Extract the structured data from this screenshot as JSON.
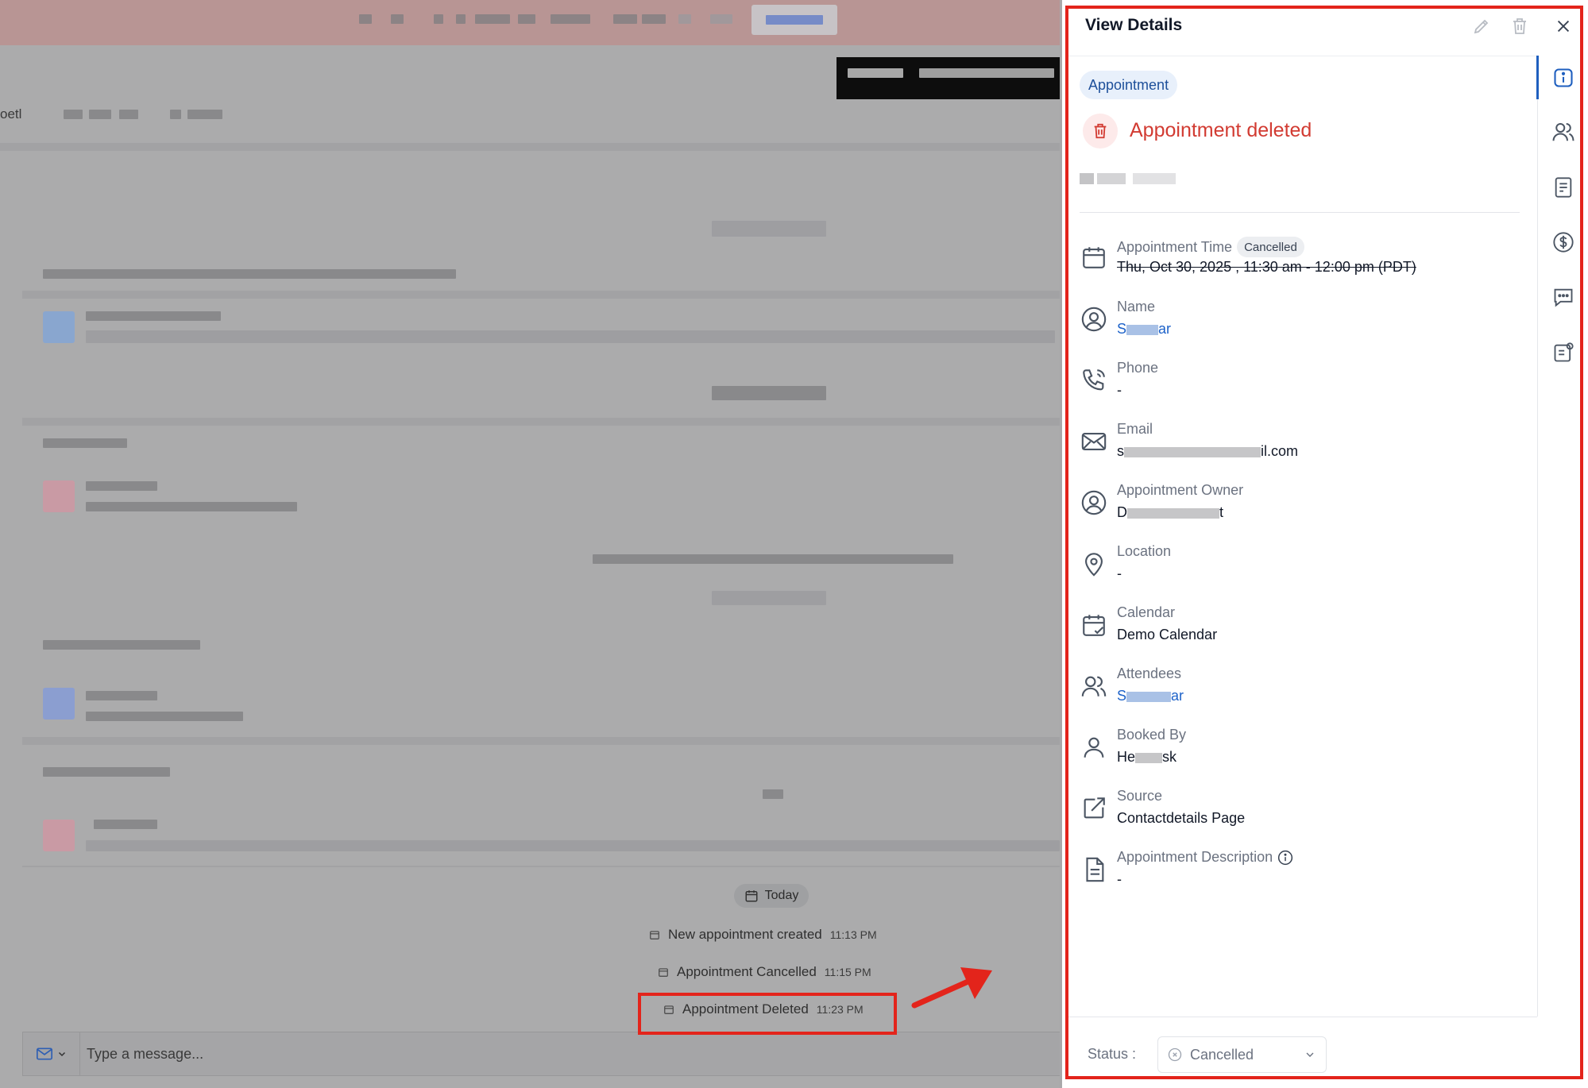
{
  "panel": {
    "title": "View Details",
    "type_chip": "Appointment",
    "headline": "Appointment deleted",
    "fields": [
      {
        "label": "Appointment Time",
        "badge": "Cancelled",
        "value": "Thu, Oct 30, 2025 , 11:30 am - 12:00 pm (PDT)",
        "icon": "calendar-icon"
      },
      {
        "label": "Name",
        "value_prefix": "S",
        "value_suffix": "ar",
        "icon": "user-circle-icon"
      },
      {
        "label": "Phone",
        "value": "-",
        "icon": "phone-icon"
      },
      {
        "label": "Email",
        "value_prefix": "s",
        "value_suffix": "il.com",
        "icon": "mail-icon"
      },
      {
        "label": "Appointment Owner",
        "value_prefix": "D",
        "value_suffix": "t",
        "icon": "user-circle-icon"
      },
      {
        "label": "Location",
        "value": "-",
        "icon": "map-pin-icon"
      },
      {
        "label": "Calendar",
        "value": "Demo Calendar",
        "icon": "calendar-check-icon"
      },
      {
        "label": "Attendees",
        "value_prefix": "S",
        "value_suffix": "ar",
        "icon": "users-icon"
      },
      {
        "label": "Booked By",
        "value_prefix": "He",
        "value_suffix": "sk",
        "icon": "user-icon"
      },
      {
        "label": "Source",
        "value": "Contactdetails Page",
        "icon": "external-link-icon"
      },
      {
        "label": "Appointment Description",
        "value": "-",
        "icon": "document-icon"
      }
    ],
    "status_label": "Status :",
    "status_value": "Cancelled"
  },
  "conversation": {
    "date_chip": "Today",
    "events": [
      {
        "label": "New appointment created",
        "time": "11:13 PM"
      },
      {
        "label": "Appointment Cancelled",
        "time": "11:15 PM"
      },
      {
        "label": "Appointment Deleted",
        "time": "11:23 PM"
      }
    ],
    "composer_placeholder": "Type a message...",
    "left_fragment": "oetl"
  },
  "colors": {
    "accent": "#1d62c9",
    "danger": "#d23b32",
    "highlight": "#e3241b"
  }
}
